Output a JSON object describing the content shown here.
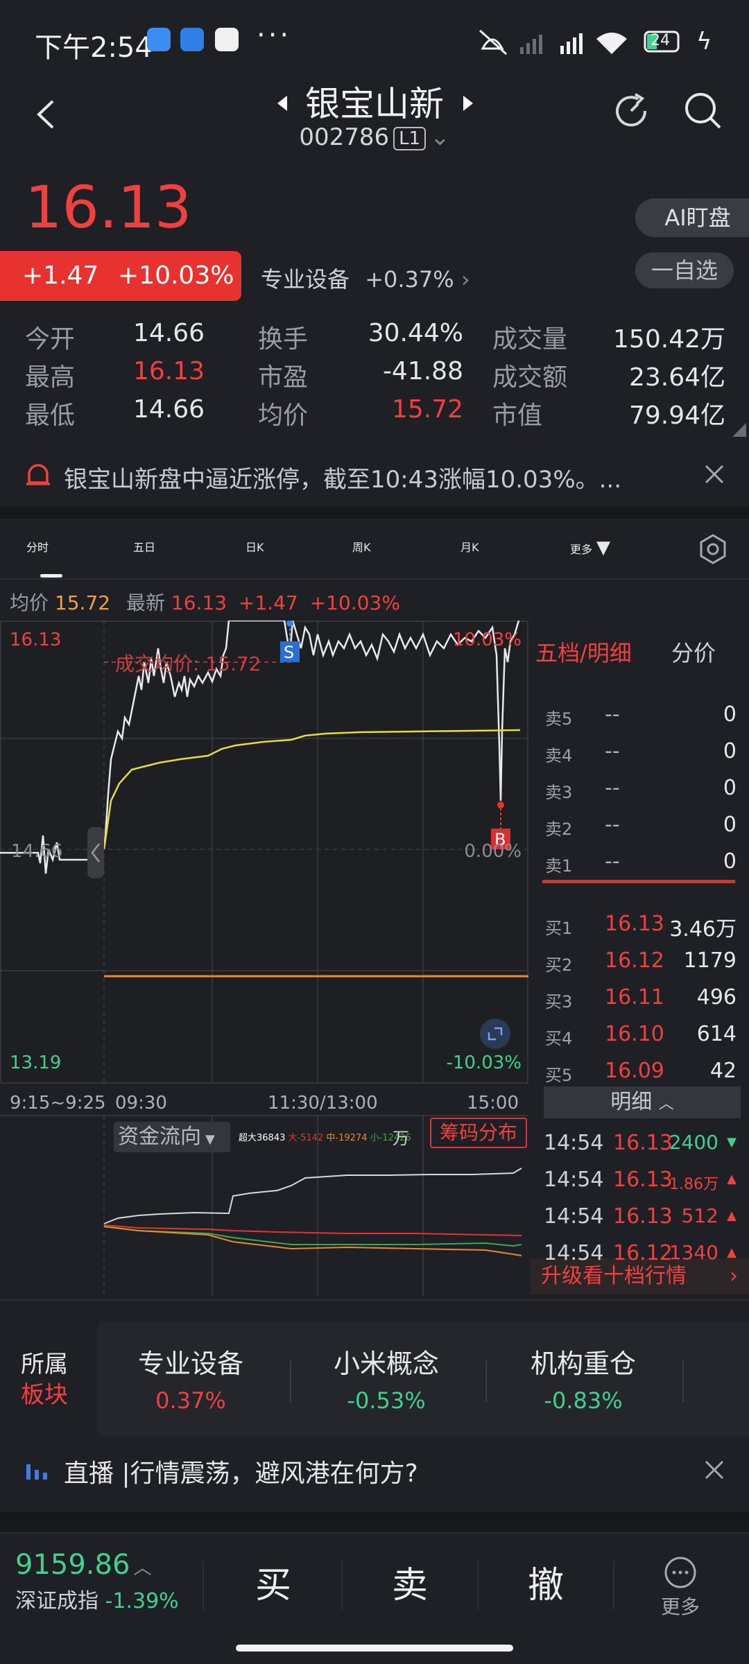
{
  "status_bar": {
    "time": "下午2:54",
    "dots": "···",
    "battery": "24"
  },
  "header": {
    "stock_name": "银宝山新",
    "code": "002786",
    "level": "L1"
  },
  "quote": {
    "price": "16.13",
    "change": "+1.47",
    "change_pct": "+10.03%",
    "sector_name": "专业设备",
    "sector_pct": "+0.37%",
    "ai_btn": "AI盯盘",
    "watch_btn": "一自选"
  },
  "stats": [
    {
      "l1": "今开",
      "v1": "14.66",
      "l2": "换手",
      "v2": "30.44%",
      "l3": "成交量",
      "v3": "150.42万"
    },
    {
      "l1": "最高",
      "v1": "16.13",
      "l2": "市盈",
      "v2": "-41.88",
      "l3": "成交额",
      "v3": "23.64亿"
    },
    {
      "l1": "最低",
      "v1": "14.66",
      "l2": "均价",
      "v2": "15.72",
      "l3": "市值",
      "v3": "79.94亿"
    }
  ],
  "alert": {
    "text": "银宝山新盘中逼近涨停，截至10:43涨幅10.03%。..."
  },
  "tabs": [
    "分时",
    "五日",
    "日K",
    "周K",
    "月K",
    "更多"
  ],
  "chart_header": {
    "avg_label": "均价",
    "avg_value": "15.72",
    "latest_label": "最新",
    "latest_value": "16.13",
    "change": "+1.47",
    "change_pct": "+10.03%"
  },
  "chart_data": {
    "type": "line",
    "y_high": "16.13",
    "y_mid": "14.66",
    "y_low": "13.19",
    "pct_high": "10.03%",
    "pct_mid": "0.00%",
    "pct_low": "-10.03%",
    "avg_line_label": "成交均价: 15.72",
    "x_labels": [
      "9:15~9:25",
      "09:30",
      "11:30/13:00",
      "15:00"
    ],
    "markers": {
      "sell": "S",
      "buy": "B"
    }
  },
  "flow": {
    "label": "资金流向",
    "legend_big": "超大36843",
    "legend_large": "大-5142",
    "legend_mid": "中-19274",
    "legend_small": "小-12426",
    "unit": "万",
    "chip_btn": "筹码分布"
  },
  "orderbook": {
    "header_left": "五档/明细",
    "header_right": "分价",
    "asks": [
      {
        "lbl": "卖5",
        "p": "--",
        "v": "0"
      },
      {
        "lbl": "卖4",
        "p": "--",
        "v": "0"
      },
      {
        "lbl": "卖3",
        "p": "--",
        "v": "0"
      },
      {
        "lbl": "卖2",
        "p": "--",
        "v": "0"
      },
      {
        "lbl": "卖1",
        "p": "--",
        "v": "0"
      }
    ],
    "bids": [
      {
        "lbl": "买1",
        "p": "16.13",
        "v": "3.46万"
      },
      {
        "lbl": "买2",
        "p": "16.12",
        "v": "1179"
      },
      {
        "lbl": "买3",
        "p": "16.11",
        "v": "496"
      },
      {
        "lbl": "买4",
        "p": "16.10",
        "v": "614"
      },
      {
        "lbl": "买5",
        "p": "16.09",
        "v": "42"
      }
    ],
    "detail_label": "明细",
    "ticks": [
      {
        "t": "14:54",
        "p": "16.13",
        "v": "2400"
      },
      {
        "t": "14:54",
        "p": "16.13",
        "v": "1.86万"
      },
      {
        "t": "14:54",
        "p": "16.13",
        "v": "512"
      },
      {
        "t": "14:54",
        "p": "16.12",
        "v": "1340"
      }
    ],
    "upgrade": "升级看十档行情"
  },
  "sectors": {
    "label_top": "所属",
    "label_bottom": "板块",
    "items": [
      {
        "name": "专业设备",
        "pct": "0.37%"
      },
      {
        "name": "小米概念",
        "pct": "-0.53%"
      },
      {
        "name": "机构重仓",
        "pct": "-0.83%"
      }
    ]
  },
  "live": {
    "text": "直播 |行情震荡，避风港在何方?"
  },
  "bottom_bar": {
    "index_value": "9159.86",
    "index_name": "深证成指",
    "index_pct": "-1.39%",
    "buy": "买",
    "sell": "卖",
    "cancel": "撤",
    "more": "更多"
  }
}
